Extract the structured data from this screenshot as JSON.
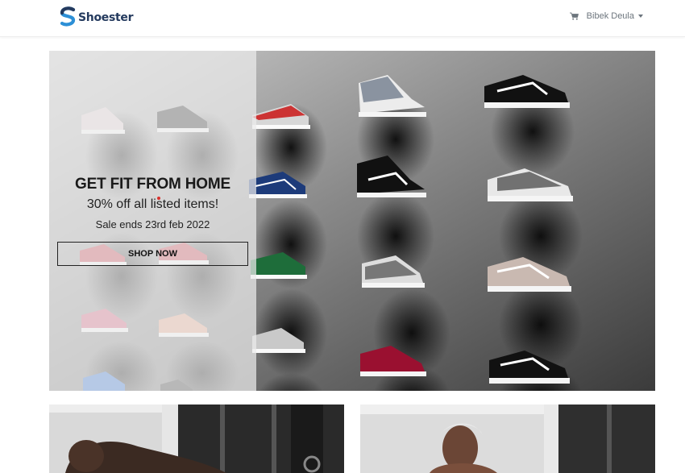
{
  "navbar": {
    "brand": "Shoester",
    "cart_icon": "cart-icon",
    "user_name": "Bibek Deula"
  },
  "hero": {
    "title": "GET FIT FROM HOME",
    "subtitle": "30% off all listed items!",
    "sale_end": "Sale ends 23rd feb 2022",
    "cta_label": "SHOP NOW"
  },
  "colors": {
    "brand_blue": "#2c8fd6",
    "brand_dark": "#243a5e",
    "accent_dot": "#d9302c"
  }
}
